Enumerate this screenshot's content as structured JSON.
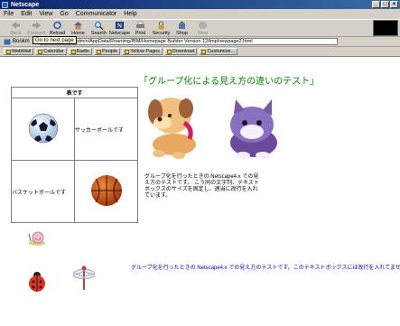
{
  "window": {
    "title": "Netscape"
  },
  "menu": [
    "File",
    "Edit",
    "View",
    "Go",
    "Communicator",
    "Help"
  ],
  "toolbar": {
    "buttons": [
      {
        "label": "Back",
        "icon": "back-arrow-icon",
        "enabled": false
      },
      {
        "label": "Forward",
        "icon": "forward-arrow-icon",
        "enabled": false
      },
      {
        "label": "Reload",
        "icon": "reload-icon",
        "enabled": true
      },
      {
        "label": "Home",
        "icon": "home-icon",
        "enabled": true
      },
      {
        "label": "Search",
        "icon": "search-icon",
        "enabled": true
      },
      {
        "label": "Netscape",
        "icon": "netscape-icon",
        "enabled": true
      },
      {
        "label": "Print",
        "icon": "print-icon",
        "enabled": true
      },
      {
        "label": "Security",
        "icon": "security-lock-icon",
        "enabled": true
      },
      {
        "label": "Shop",
        "icon": "shop-icon",
        "enabled": true
      },
      {
        "label": "Stop",
        "icon": "stop-icon",
        "enabled": false
      }
    ]
  },
  "location": {
    "bookmarks_label": "Bookm",
    "url_label": "n:",
    "url": "file:///C|/Users/admin/AppData/Roaming/IBM/Homepage Builder Version 12/tmp/newpage2.html"
  },
  "tooltip": "Go to next page",
  "personal_toolbar": [
    "WebMail",
    "Calendar",
    "Radio",
    "People",
    "Yellow Pages",
    "Download",
    "Customize..."
  ],
  "page": {
    "title": "「グループ化による見え方の違いのテスト」",
    "table_header": "表です",
    "soccer_label": "サッカーボールです",
    "basketball_label": "バスケットボールです",
    "caption1": "グループ化を行ったときの Netscape4.x での見え方のテストです。 こう同の文字列、テキストボックスのサイズを固定し、適当に改行を入れています。",
    "caption2": "グループ化を行ったときの Netscape4.x での見え方のテストです。このテキストボックスには改行を入れてません。"
  },
  "colors": {
    "title_green": "#008000",
    "caption_blue": "#0000c0",
    "titlebar": "#0a246a"
  }
}
